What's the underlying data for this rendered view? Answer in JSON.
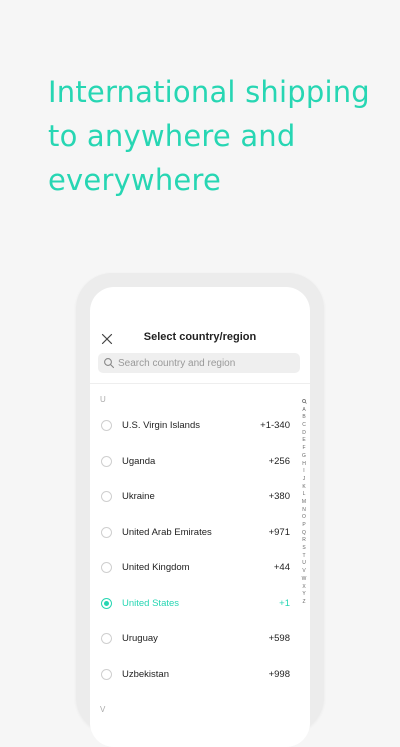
{
  "headline": {
    "line1": "International shipping",
    "line2": "to anywhere and",
    "line3": "everywhere"
  },
  "colors": {
    "accent": "#27d6b3",
    "background": "#f6f6f6",
    "text": "#222222",
    "muted": "#aaaaaa"
  },
  "dialog": {
    "title": "Select country/region",
    "close_icon": "close-icon"
  },
  "search": {
    "placeholder": "Search country and region",
    "value": "",
    "icon": "search-icon"
  },
  "section_letter": "U",
  "next_section_letter": "V",
  "countries": [
    {
      "name": "U.S. Virgin Islands",
      "code": "+1-340",
      "selected": false
    },
    {
      "name": "Uganda",
      "code": "+256",
      "selected": false
    },
    {
      "name": "Ukraine",
      "code": "+380",
      "selected": false
    },
    {
      "name": "United Arab Emirates",
      "code": "+971",
      "selected": false
    },
    {
      "name": "United Kingdom",
      "code": "+44",
      "selected": false
    },
    {
      "name": "United States",
      "code": "+1",
      "selected": true
    },
    {
      "name": "Uruguay",
      "code": "+598",
      "selected": false
    },
    {
      "name": "Uzbekistan",
      "code": "+998",
      "selected": false
    }
  ],
  "alphabet_index": [
    "A",
    "B",
    "C",
    "D",
    "E",
    "F",
    "G",
    "H",
    "I",
    "J",
    "K",
    "L",
    "M",
    "N",
    "O",
    "P",
    "Q",
    "R",
    "S",
    "T",
    "U",
    "V",
    "W",
    "X",
    "Y",
    "Z"
  ]
}
